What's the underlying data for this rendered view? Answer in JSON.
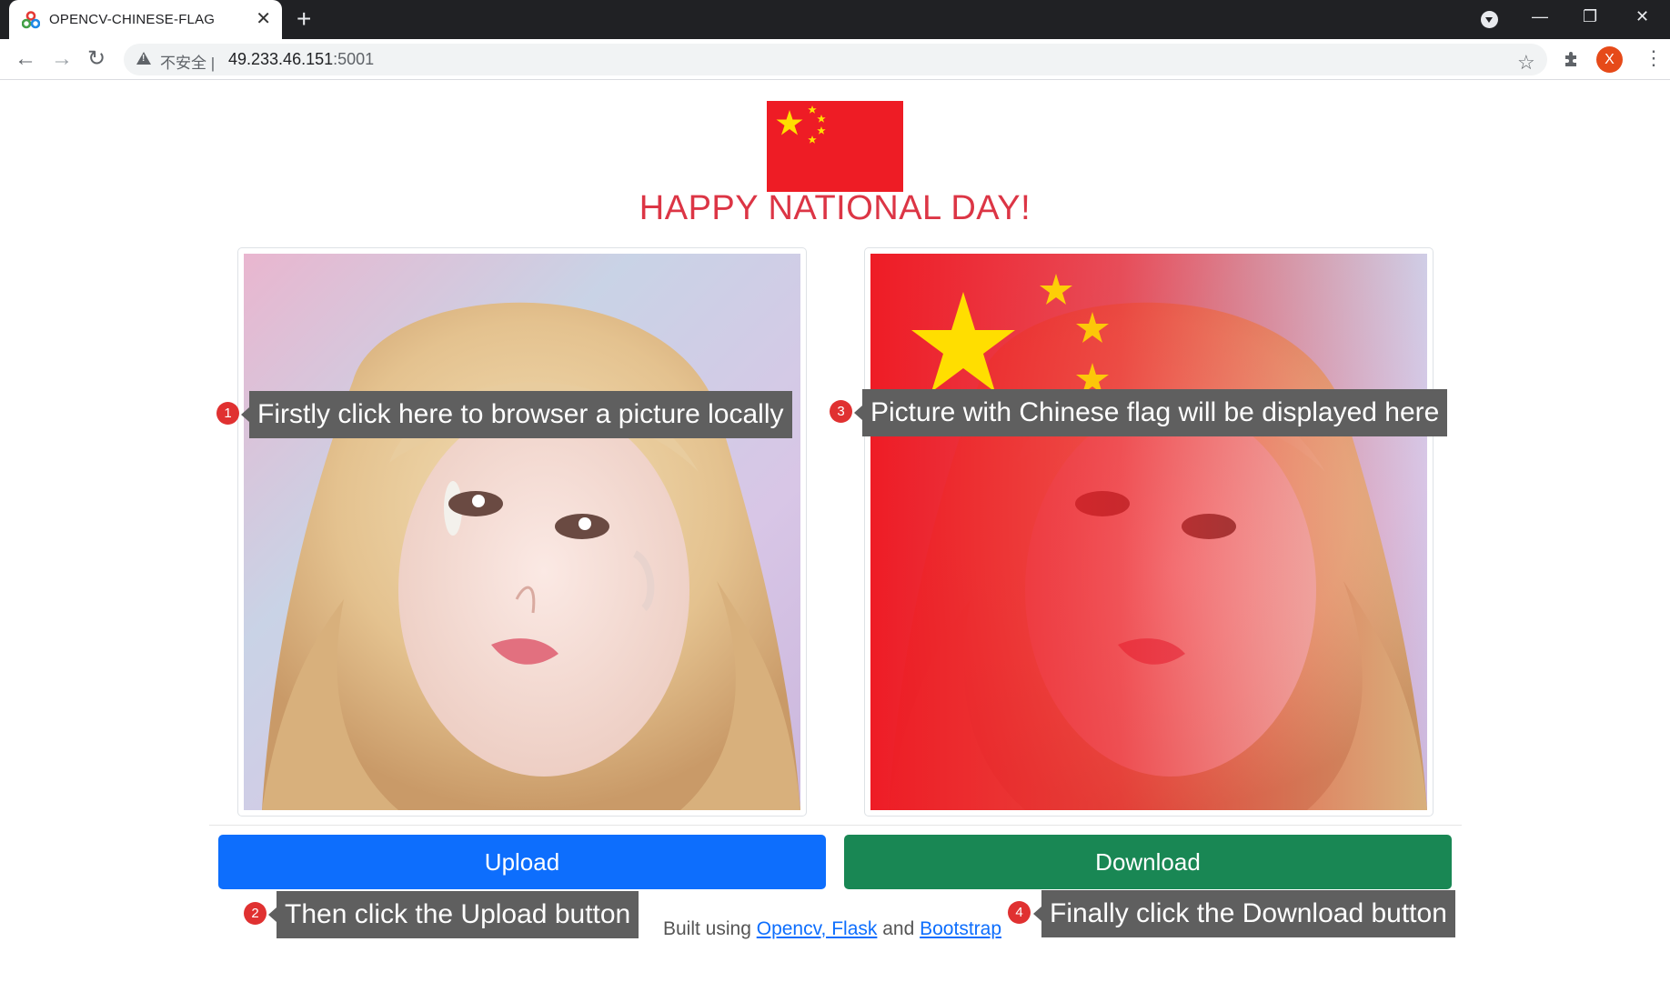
{
  "browser": {
    "tab_title": "OPENCV-CHINESE-FLAG",
    "tab_close": "✕",
    "new_tab": "+",
    "security_label": "不安全",
    "separator": "|",
    "url_host": "49.233.46.151",
    "url_port": ":5001",
    "avatar_initial": "X",
    "window_controls": [
      "—",
      "❐",
      "✕"
    ]
  },
  "page": {
    "heading": "HAPPY NATIONAL DAY!",
    "upload_label": "Upload",
    "download_label": "Download",
    "footer": {
      "prefix": "Built using",
      "link1": "Opencv, Flask",
      "middle": "and",
      "link2": "Bootstrap"
    }
  },
  "annotations": [
    {
      "number": "1",
      "text": "Firstly click here to browser a picture locally"
    },
    {
      "number": "2",
      "text": "Then click the Upload button"
    },
    {
      "number": "3",
      "text": "Picture with Chinese flag will be displayed here"
    },
    {
      "number": "4",
      "text": "Finally click the Download button"
    }
  ],
  "colors": {
    "flag_red": "#ee1c25",
    "flag_yellow": "#ffde00",
    "heading_red": "#dc3545",
    "upload_blue": "#0d6efd",
    "download_green": "#198754"
  }
}
